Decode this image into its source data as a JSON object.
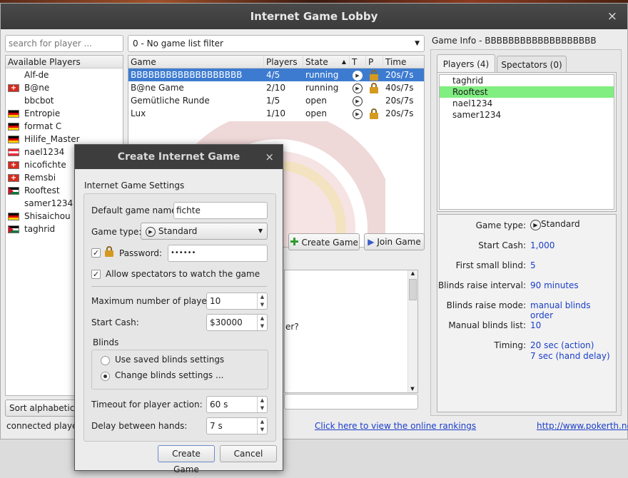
{
  "window": {
    "title": "Internet Game Lobby",
    "close": "×"
  },
  "search": {
    "placeholder": "search for player ..."
  },
  "filter": {
    "selected": "0 - No game list filter"
  },
  "players": {
    "header": "Available Players",
    "items": [
      {
        "name": "Alf-de",
        "flag": "none"
      },
      {
        "name": "B@ne",
        "flag": "ch"
      },
      {
        "name": "bbcbot",
        "flag": "none"
      },
      {
        "name": "Entropie",
        "flag": "de"
      },
      {
        "name": "format C",
        "flag": "de"
      },
      {
        "name": "Hilife_Master",
        "flag": "de"
      },
      {
        "name": "nael1234",
        "flag": "at"
      },
      {
        "name": "nicofichte",
        "flag": "ch"
      },
      {
        "name": "Remsbi",
        "flag": "ch"
      },
      {
        "name": "Rooftest",
        "flag": "jo"
      },
      {
        "name": "samer1234",
        "flag": "none"
      },
      {
        "name": "Shisaichou",
        "flag": "de"
      },
      {
        "name": "taghrid",
        "flag": "jo"
      }
    ]
  },
  "sort_label": "Sort alphabeticall",
  "connected_label": "connected players",
  "games": {
    "columns": [
      "Game",
      "Players",
      "State",
      "T",
      "P",
      "Time"
    ],
    "rows": [
      {
        "name": "BBBBBBBBBBBBBBBBBBB",
        "players": "4/5",
        "state": "running",
        "locked": true,
        "time": "20s/7s",
        "selected": true
      },
      {
        "name": "B@ne Game",
        "players": "2/10",
        "state": "running",
        "locked": true,
        "time": "40s/7s"
      },
      {
        "name": "Gemütliche Runde",
        "players": "1/5",
        "state": "open",
        "locked": false,
        "time": "20s/7s"
      },
      {
        "name": "Lux",
        "players": "1/10",
        "state": "open",
        "locked": true,
        "time": "20s/7s"
      }
    ]
  },
  "create_game": "Create Game",
  "join_game": "Join Game",
  "chat_fragment": "er?",
  "rankings_link": "Click here to view the online rankings",
  "site_link": "http://www.pokerth.net",
  "gameinfo": {
    "title": "Game Info - BBBBBBBBBBBBBBBBBBB",
    "tab_players": "Players (4)",
    "tab_spectators": "Spectators (0)",
    "players": [
      "taghrid",
      "Rooftest",
      "nael1234",
      "samer1234"
    ],
    "highlight": "Rooftest",
    "labels": {
      "type": "Game type:",
      "cash": "Start Cash:",
      "blind": "First small blind:",
      "interval": "Blinds raise interval:",
      "mode": "Blinds raise mode:",
      "manual": "Manual blinds list:",
      "timing": "Timing:"
    },
    "values": {
      "type": "Standard",
      "cash": "1,000",
      "blind": "5",
      "interval": "90 minutes",
      "mode": "manual blinds order",
      "manual": "10",
      "timing1": "20 sec (action)",
      "timing2": "7 sec (hand delay)"
    }
  },
  "dialog": {
    "title": "Create Internet Game",
    "close": "×",
    "group": "Internet Game Settings",
    "name_label": "Default game name:",
    "name_value": "fichte",
    "type_label": "Game type:",
    "type_value": "Standard",
    "password_label": "Password:",
    "password_value": "••••••",
    "password_checked": "✓",
    "spectators_label": "Allow spectators to watch the game",
    "spectators_checked": "✓",
    "max_label": "Maximum number of players:",
    "max_value": "10",
    "cash_label": "Start Cash:",
    "cash_value": "$30000",
    "blinds_label": "Blinds",
    "saved_blinds": "Use saved blinds settings",
    "change_blinds": "Change blinds settings ...",
    "timeout_label": "Timeout for player action:",
    "timeout_value": "60 s",
    "delay_label": "Delay between hands:",
    "delay_value": "7 s",
    "create": "Create Game",
    "cancel": "Cancel"
  }
}
